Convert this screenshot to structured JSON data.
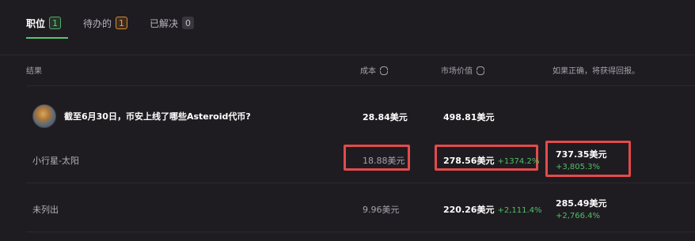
{
  "tabs": [
    {
      "label": "职位",
      "count": "1"
    },
    {
      "label": "待办的",
      "count": "1"
    },
    {
      "label": "已解决",
      "count": "0"
    }
  ],
  "columns": {
    "outcome": "结果",
    "cost": "成本",
    "market_value": "市场价值",
    "payout": "如果正确，将获得回报。"
  },
  "market": {
    "question": "截至6月30日，币安上线了哪些Asteroid代币?",
    "cost": "28.84美元",
    "market_value": "498.81美元"
  },
  "rows": [
    {
      "outcome": "小行星-太阳",
      "cost": "18.88美元",
      "market_value": "278.56美元",
      "market_change": "+1374.2%",
      "payout": "737.35美元",
      "payout_change": "+3,805.3%"
    },
    {
      "outcome": "未列出",
      "cost": "9.96美元",
      "market_value": "220.26美元",
      "market_change": "+2,111.4%",
      "payout": "285.49美元",
      "payout_change": "+2,766.4%"
    }
  ],
  "colors": {
    "accent_green": "#58c46f",
    "highlight_red": "#e24b4b",
    "background": "#1f1c21"
  }
}
